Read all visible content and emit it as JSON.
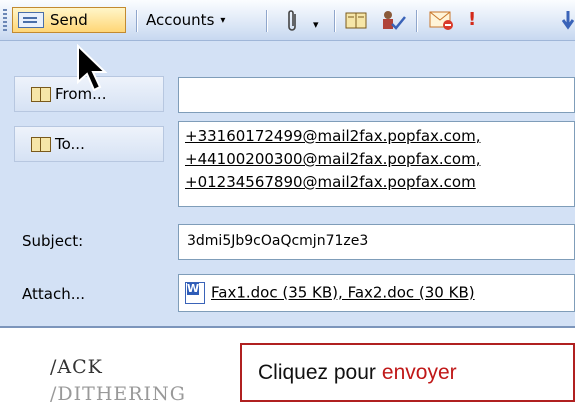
{
  "toolbar": {
    "send_label": "Send",
    "accounts_label": "Accounts",
    "accounts_caret": "▾",
    "attach_caret": "▾",
    "importance_glyph": "!"
  },
  "header": {
    "from_label": "From...",
    "to_label": "To...",
    "to_recipients": [
      "+33160172499@mail2fax.popfax.com,",
      "+44100200300@mail2fax.popfax.com,",
      "+01234567890@mail2fax.popfax.com"
    ],
    "subject_label": "Subject:",
    "subject_value": "3dmi5Jb9cOaQcmjn71ze3",
    "attach_label": "Attach...",
    "attach_value": "Fax1.doc (35 KB), Fax2.doc (30 KB)"
  },
  "body": {
    "line1": "/ACK",
    "line2": "/DITHERING"
  },
  "callout": {
    "text": "Cliquez pour",
    "emphasis": "envoyer"
  },
  "colors": {
    "header_bg": "#d3e1f5",
    "callout_border": "#b02020",
    "callout_emphasis": "#c01818",
    "send_highlight": "#ffd676"
  }
}
